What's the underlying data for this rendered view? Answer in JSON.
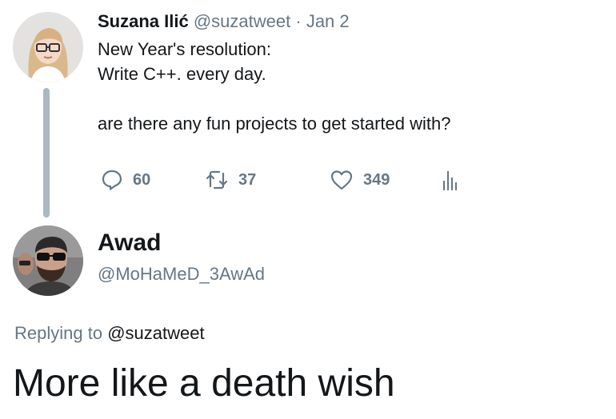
{
  "original_tweet": {
    "author_name": "Suzana Ilić",
    "author_handle": "@suzatweet",
    "separator": "·",
    "date": "Jan 2",
    "lines": [
      "New Year's resolution:",
      "Write C++. every day.",
      "",
      "are there any fun projects to get started with?"
    ],
    "actions": {
      "reply_icon": "reply-icon",
      "reply_count": "60",
      "retweet_icon": "retweet-icon",
      "retweet_count": "37",
      "like_icon": "heart-icon",
      "like_count": "349",
      "stats_icon": "analytics-icon"
    }
  },
  "reply": {
    "author_name": "Awad",
    "author_handle": "@MoHaMeD_3AwAd",
    "replying_prefix": "Replying to",
    "replying_mention": "@suzatweet",
    "text": "More like a death wish"
  },
  "colors": {
    "text": "#14171a",
    "secondary": "#657786",
    "thread_line": "#aab8c2"
  }
}
